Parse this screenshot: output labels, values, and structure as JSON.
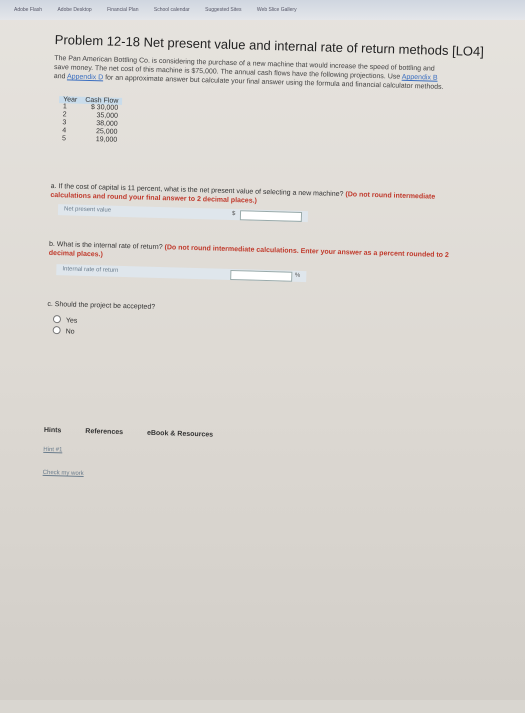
{
  "bookmarks": [
    "Adobe Flash",
    "Adobe Desktop",
    "Financial Plan",
    "School calendar",
    "Suggested Sites",
    "Web Slice Gallery"
  ],
  "problem": {
    "title": "Problem 12-18 Net present value and internal rate of return methods [LO4]",
    "intro_part1": "The Pan American Bottling Co. is considering the purchase of a new machine that would increase the speed of bottling and save money. The net cost of this machine is $75,000. The annual cash flows have the following projections. Use ",
    "appendix_b": "Appendix B",
    "intro_and": " and ",
    "appendix_d": "Appendix D",
    "intro_part2": " for an approximate answer but calculate your final answer using the formula and financial calculator methods."
  },
  "cash_flow_table": {
    "headers": [
      "Year",
      "Cash Flow"
    ],
    "rows": [
      {
        "year": "1",
        "cash": "$ 30,000"
      },
      {
        "year": "2",
        "cash": "35,000"
      },
      {
        "year": "3",
        "cash": "38,000"
      },
      {
        "year": "4",
        "cash": "25,000"
      },
      {
        "year": "5",
        "cash": "19,000"
      }
    ]
  },
  "question_a": {
    "text": "a. If the cost of capital is 11 percent, what is the net present value of selecting a new machine? ",
    "instruction": "(Do not round intermediate calculations and round your final answer to 2 decimal places.)",
    "field_label": "Net present value",
    "prefix": "$",
    "value": ""
  },
  "question_b": {
    "text": "b. What is the internal rate of return? ",
    "instruction": "(Do not round intermediate calculations. Enter your answer as a percent rounded to 2 decimal places.)",
    "field_label": "Internal rate of return",
    "suffix": "%",
    "value": ""
  },
  "question_c": {
    "text": "c. Should the project be accepted?",
    "options": [
      "Yes",
      "No"
    ]
  },
  "footer": {
    "tabs": [
      "Hints",
      "References",
      "eBook & Resources"
    ],
    "hint_link": "Hint #1",
    "check_link": "Check my work"
  }
}
